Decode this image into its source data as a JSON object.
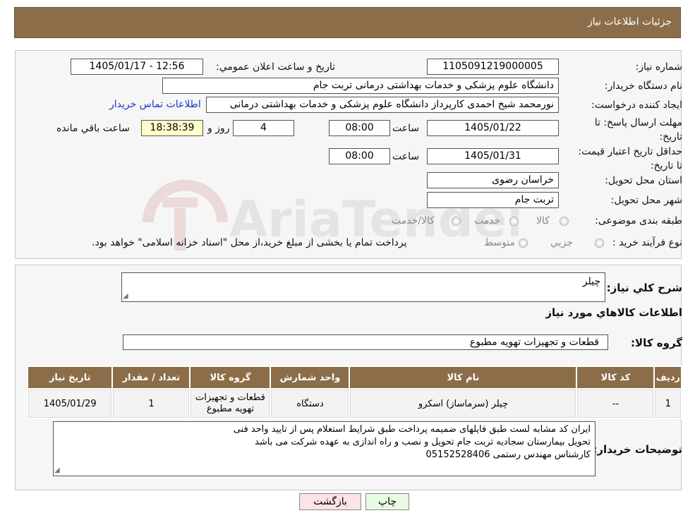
{
  "header": {
    "title": "جزئیات اطلاعات نیاز"
  },
  "form": {
    "need_number_label": "شماره نیاز:",
    "need_number": "1105091219000005",
    "announce_label": "تاریخ و ساعت اعلان عمومي:",
    "announce_value": "1405/01/17 - 12:56",
    "buyer_label": "نام دستگاه خریدار:",
    "buyer_value": "دانشگاه علوم پزشکی و خدمات بهداشتی  درمانی تربت جام",
    "creator_label": "ایجاد کننده درخواست:",
    "creator_value": "نورمحمد شیخ احمدی کارپرداز دانشگاه علوم پزشکی و خدمات بهداشتی  درمانی",
    "contact_link": "اطلاعات تماس خریدار",
    "deadline_label": "مهلت ارسال پاسخ: تا تاریخ:",
    "deadline_date": "1405/01/22",
    "time_label": "ساعت",
    "deadline_time": "08:00",
    "days_value": "4",
    "days_label": "روز و",
    "remaining_time": "18:38:39",
    "remaining_label": "ساعت باقي مانده",
    "validity_label": "حداقل تاریخ اعتبار قیمت: تا تاریخ:",
    "validity_date": "1405/01/31",
    "validity_time": "08:00",
    "province_label": "استان محل تحویل:",
    "province_value": "خراسان رضوی",
    "city_label": "شهر محل تحویل:",
    "city_value": "تربت جام",
    "category_label": "طبقه بندی موضوعی:",
    "category_options": [
      "کالا",
      "خدمت",
      "کالا/خدمت"
    ],
    "process_label": "نوع فرآیند خرید :",
    "process_options": [
      "جزیي",
      "متوسط"
    ],
    "process_note": "پرداخت تمام یا بخشی از مبلغ خرید،از محل \"اسناد خزانه اسلامی\" خواهد بود."
  },
  "summary": {
    "desc_label": "شرح کلي نیاز:",
    "desc_value": "چیلر",
    "goods_info_title": "اطلاعات کالاهاي مورد نیاز",
    "group_label": "گروه کالا:",
    "group_value": "قطعات و تجهیزات تهویه مطبوع",
    "table": {
      "headers": [
        "ردیف",
        "کد کالا",
        "نام کالا",
        "واحد شمارش",
        "گروه کالا",
        "تعداد / مقدار",
        "تاریخ نیاز"
      ],
      "rows": [
        [
          "1",
          "--",
          "چیلر (سرماساز) اسکرو",
          "دستگاه",
          "قطعات و تجهیزات تهویه مطبوع",
          "1",
          "1405/01/29"
        ]
      ]
    },
    "buyer_notes_label": "توضیحات خریدار:",
    "buyer_notes": [
      "ایران کد مشابه لست طبق فایلهای ضمیمه پرداخت طبق شرایط استعلام پس از تایید واحد فنی",
      "تحویل بیمارستان سجادیه تربت جام تحویل و نصب و راه اندازی به عهده شرکت می باشد",
      "کارشناس مهندس رستمی 05152528406"
    ]
  },
  "buttons": {
    "print": "چاپ",
    "back": "بازگشت"
  },
  "watermark": {
    "text": "AriaTender.neT"
  },
  "colors": {
    "header_bg": "#8b6e49",
    "table_header_bg": "#8b6e49",
    "print_btn_bg": "#e8fbe3",
    "back_btn_bg": "#fde3e3",
    "link": "#1a37c8"
  }
}
